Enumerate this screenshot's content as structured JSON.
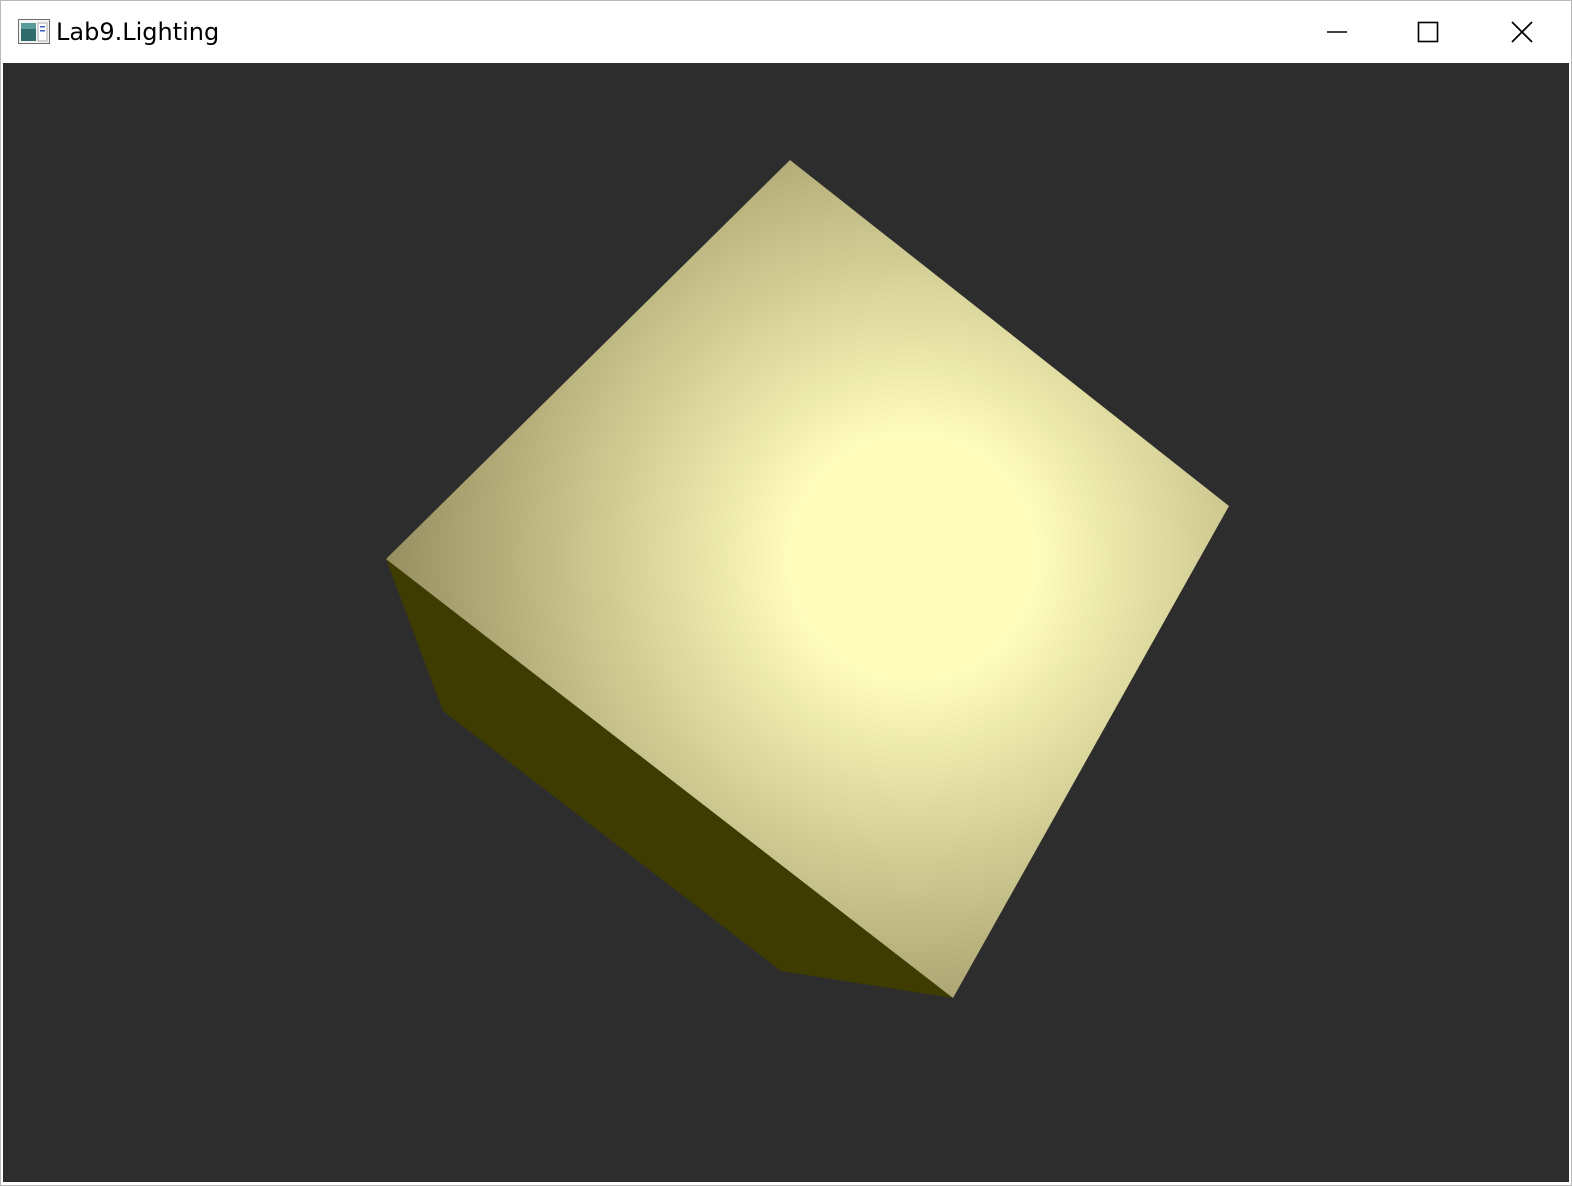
{
  "window": {
    "title": "Lab9.Lighting",
    "icon": "application-window-icon",
    "controls": {
      "minimize": "minimize-icon",
      "maximize": "maximize-icon",
      "close": "close-icon"
    }
  },
  "viewport": {
    "background_color": "#2d2d2d",
    "object": "lit-cube",
    "lit_face_highlight_color": "#fffcbc",
    "lit_face_base_color": "#8f8659",
    "shadow_face_color": "#3e3c00"
  }
}
